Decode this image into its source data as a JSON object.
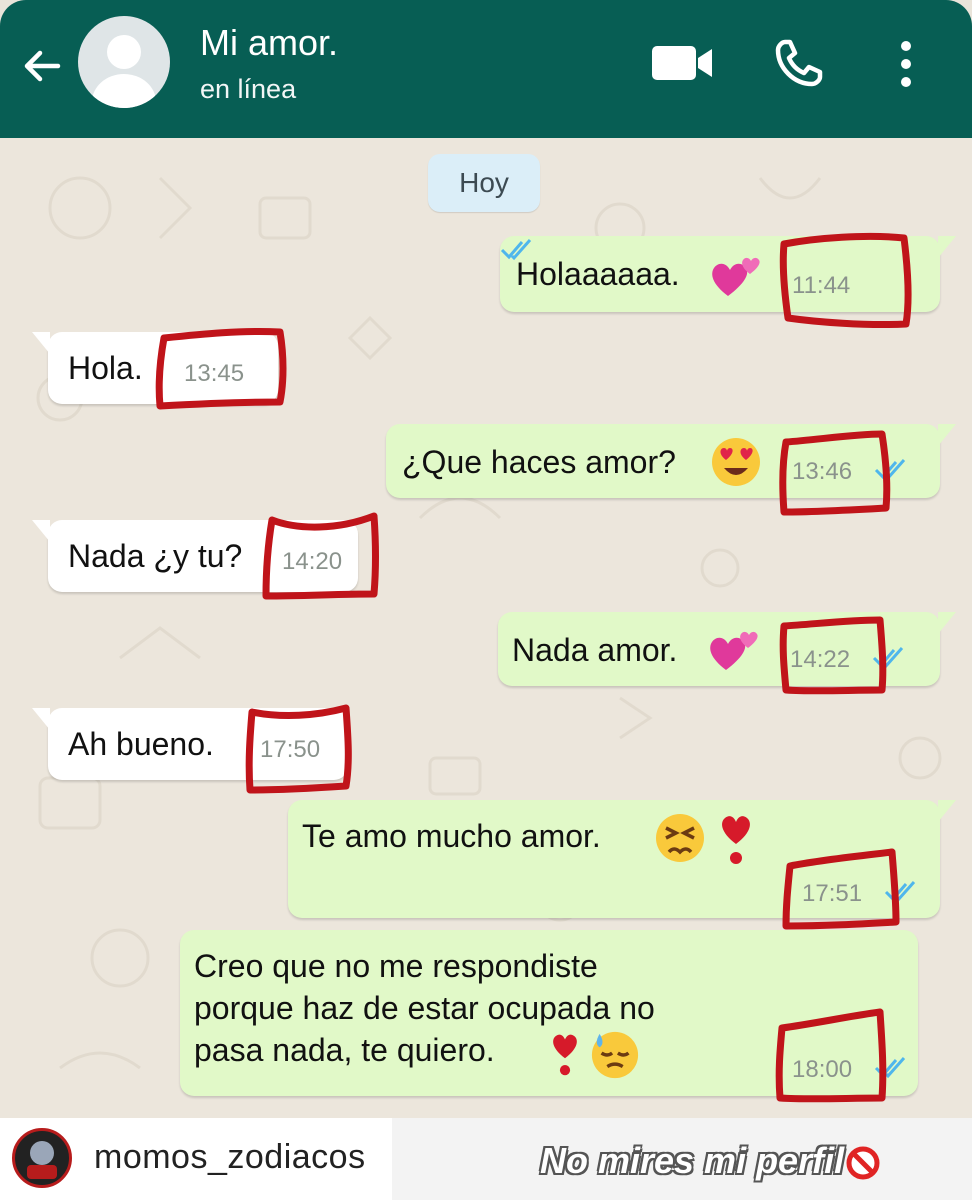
{
  "header": {
    "contact_name": "Mi amor.",
    "status": "en línea",
    "color": "#075e54"
  },
  "chat": {
    "date_chip": "Hoy",
    "messages": [
      {
        "direction": "out",
        "text": "Holaaaaaa.",
        "emoji": "two-hearts",
        "time": "11:44",
        "read": true
      },
      {
        "direction": "in",
        "text": "Hola.",
        "time": "13:45"
      },
      {
        "direction": "out",
        "text": "¿Que haces amor?",
        "emoji": "heart-eyes",
        "time": "13:46",
        "read": true
      },
      {
        "direction": "in",
        "text": "Nada ¿y tu?",
        "time": "14:20"
      },
      {
        "direction": "out",
        "text": "Nada amor.",
        "emoji": "two-hearts",
        "time": "14:22",
        "read": true
      },
      {
        "direction": "in",
        "text": "Ah bueno.",
        "time": "17:50"
      },
      {
        "direction": "out",
        "text": "Te amo mucho amor.",
        "emoji": "persevering-face heart-exclamation",
        "time": "17:51",
        "read": true
      },
      {
        "direction": "out",
        "lines": [
          "Creo que no me respondiste",
          "porque haz de estar ocupada no",
          "pasa nada, te quiero."
        ],
        "emoji": "heart-exclamation downcast-sweat",
        "time": "18:00",
        "read": true
      }
    ],
    "highlight_color": "#c0141a",
    "out_bubble_color": "#e1f9c8",
    "in_bubble_color": "#ffffff"
  },
  "footer": {
    "username": "momos_zodiacos",
    "tagline": "No mires mi perfil",
    "tagline_icon": "prohibited-icon"
  }
}
